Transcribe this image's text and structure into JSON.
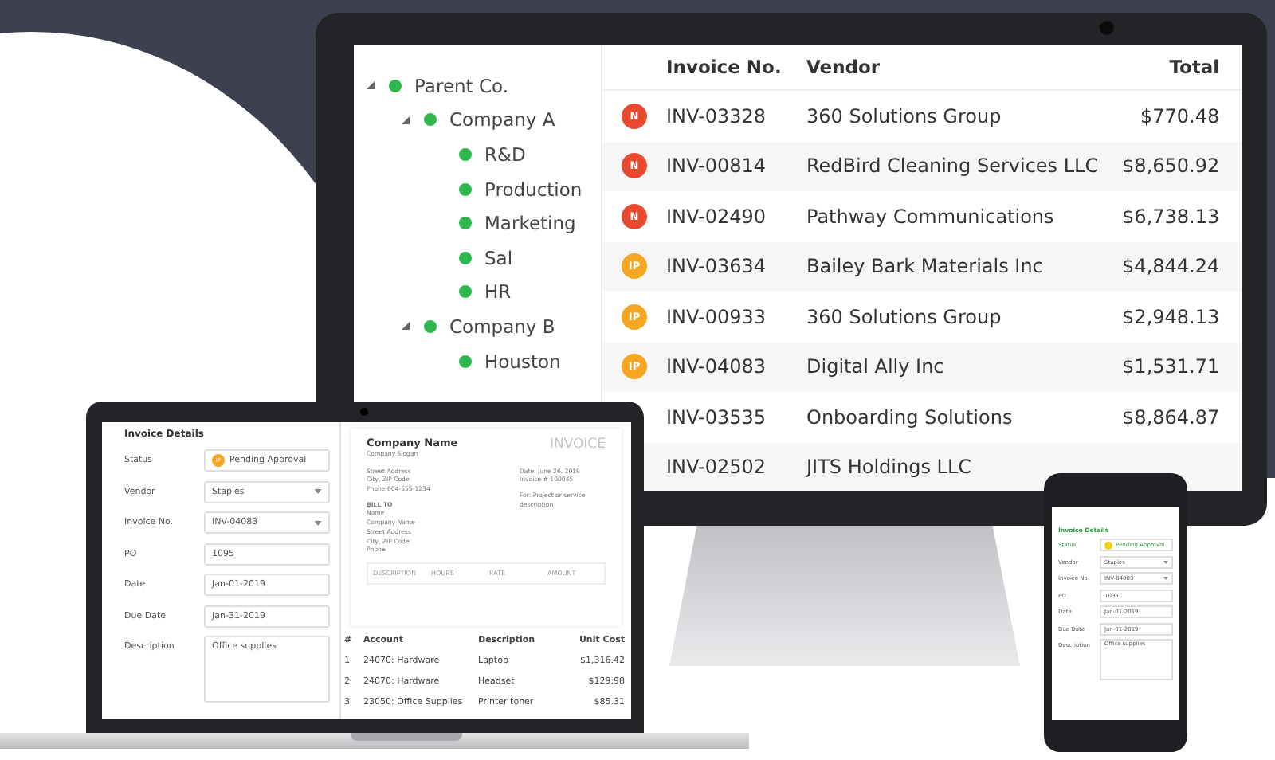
{
  "tree": [
    {
      "label": "Parent Co.",
      "expanded": true,
      "children": [
        {
          "label": "Company A",
          "expanded": true,
          "children": [
            {
              "label": "R&D"
            },
            {
              "label": "Production"
            },
            {
              "label": "Marketing"
            },
            {
              "label": "Sal"
            },
            {
              "label": "HR"
            }
          ]
        },
        {
          "label": "Company B",
          "expanded": true,
          "children": [
            {
              "label": "Houston"
            }
          ]
        }
      ]
    }
  ],
  "invoices": {
    "columns": [
      "Invoice No.",
      "Vendor",
      "Total"
    ],
    "rows": [
      {
        "status": "N",
        "color": "#e8492f",
        "number": "INV-03328",
        "vendor": "360 Solutions Group",
        "total": "$770.48"
      },
      {
        "status": "N",
        "color": "#e8492f",
        "number": "INV-00814",
        "vendor": "RedBird Cleaning Services LLC",
        "total": "$8,650.92"
      },
      {
        "status": "N",
        "color": "#e8492f",
        "number": "INV-02490",
        "vendor": "Pathway Communications",
        "total": "$6,738.13"
      },
      {
        "status": "IP",
        "color": "#f5a623",
        "number": "INV-03634",
        "vendor": "Bailey Bark Materials Inc",
        "total": "$4,844.24"
      },
      {
        "status": "IP",
        "color": "#f5a623",
        "number": "INV-00933",
        "vendor": "360 Solutions Group",
        "total": "$2,948.13"
      },
      {
        "status": "IP",
        "color": "#f5a623",
        "number": "INV-04083",
        "vendor": "Digital Ally Inc",
        "total": "$1,531.71"
      },
      {
        "number": "INV-03535",
        "vendor": "Onboarding Solutions",
        "total": "$8,864.87"
      },
      {
        "number": "INV-02502",
        "vendor": "JITS Holdings LLC"
      }
    ]
  },
  "laptop_form": {
    "title": "Invoice Details",
    "fields": [
      {
        "label": "Status",
        "kind": "status",
        "badge": "IP",
        "value": "Pending Approval"
      },
      {
        "label": "Vendor",
        "kind": "select",
        "value": "Staples"
      },
      {
        "label": "Invoice No.",
        "kind": "select",
        "value": "INV-04083"
      },
      {
        "label": "PO",
        "kind": "text",
        "value": "1095"
      },
      {
        "label": "Date",
        "kind": "text",
        "value": "Jan-01-2019"
      },
      {
        "label": "Due Date",
        "kind": "text",
        "value": "Jan-31-2019"
      },
      {
        "label": "Description",
        "kind": "textarea",
        "value": "Office supplies"
      }
    ]
  },
  "invoice_preview": {
    "company": "Company Name",
    "slogan": "Company Slogan",
    "title": "INVOICE",
    "from_lines": [
      "Street Address",
      "City, ZIP Code",
      "Phone 604-555-1234"
    ],
    "date": "Date: June 26, 2019",
    "number": "Invoice # 100045",
    "for": "For: Project or service description",
    "bill_to": "BILL TO",
    "bill_lines": [
      "Name",
      "Company Name",
      "Street Address",
      "City, ZIP Code",
      "Phone"
    ],
    "table_columns": [
      "DESCRIPTION",
      "HOURS",
      "RATE",
      "AMOUNT"
    ]
  },
  "line_items": {
    "columns": [
      "#",
      "Account",
      "Description",
      "Unit Cost"
    ],
    "rows": [
      {
        "index": "1",
        "account": "24070: Hardware",
        "description": "Laptop",
        "cost": "$1,316.42"
      },
      {
        "index": "2",
        "account": "24070: Hardware",
        "description": "Headset",
        "cost": "$129.98"
      },
      {
        "index": "3",
        "account": "23050: Office Supplies",
        "description": "Printer toner",
        "cost": "$85.31"
      }
    ]
  },
  "phone_form": {
    "title": "Invoice Details",
    "fields": [
      {
        "label": "Status",
        "kind": "status",
        "value": "Pending Approval"
      },
      {
        "label": "Vendor",
        "kind": "select",
        "value": "Staples"
      },
      {
        "label": "Invoice No.",
        "kind": "select",
        "value": "INV-04083"
      },
      {
        "label": "PO",
        "kind": "text",
        "value": "1095"
      },
      {
        "label": "Date",
        "kind": "text",
        "value": "Jan-01-2019"
      },
      {
        "label": "Due Date",
        "kind": "text",
        "value": "Jan-01-2019"
      },
      {
        "label": "Description",
        "kind": "textarea",
        "value": "Office supplies"
      }
    ]
  }
}
